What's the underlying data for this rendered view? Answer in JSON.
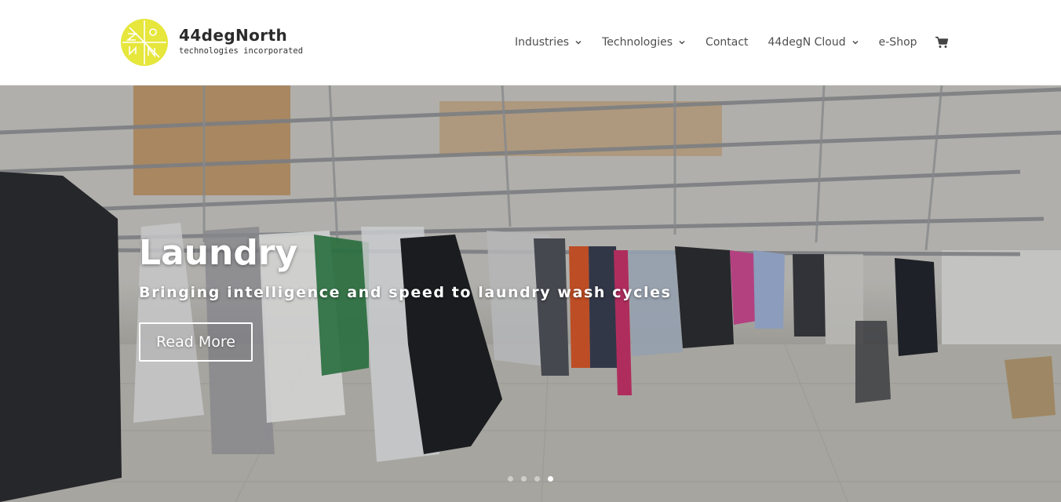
{
  "header": {
    "logo": {
      "name": "44degNorth",
      "tagline": "technologies incorporated",
      "mark_color": "#e6e63c"
    },
    "nav": [
      {
        "label": "Industries",
        "dropdown": true
      },
      {
        "label": "Technologies",
        "dropdown": true
      },
      {
        "label": "Contact",
        "dropdown": false
      },
      {
        "label": "44degN Cloud",
        "dropdown": true
      },
      {
        "label": "e-Shop",
        "dropdown": false
      }
    ],
    "cart_icon": "shopping-cart-icon"
  },
  "hero": {
    "title": "Laundry",
    "subtitle": "Bringing intelligence and speed to laundry wash cycles",
    "button_label": "Read More",
    "slides_total": 4,
    "active_slide": 4
  },
  "colors": {
    "nav_text": "#4f4f4f",
    "logo_text": "#2b2b2b",
    "accent_yellow": "#e6e63c",
    "hero_text": "#ffffff"
  }
}
